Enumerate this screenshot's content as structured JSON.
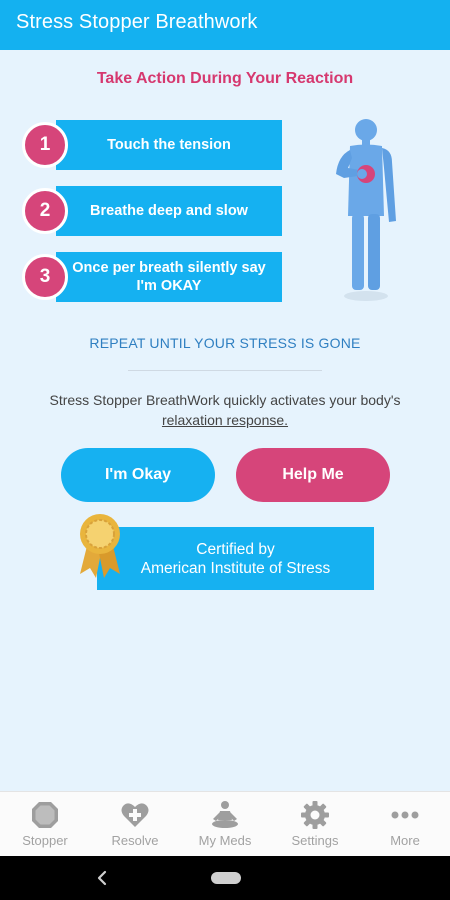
{
  "app": {
    "title": "Stress Stopper Breathwork"
  },
  "main": {
    "headline": "Take Action During Your Reaction",
    "steps": [
      {
        "number": "1",
        "text": "Touch the tension"
      },
      {
        "number": "2",
        "text": "Breathe deep and slow"
      },
      {
        "number": "3",
        "text": "Once per breath silently say I'm OKAY"
      }
    ],
    "repeat_text": "REPEAT UNTIL YOUR STRESS IS GONE",
    "description_prefix": "Stress Stopper BreathWork quickly activates your body's",
    "description_link": "relaxation response.",
    "buttons": {
      "okay": "I'm Okay",
      "help": "Help Me"
    },
    "certification": {
      "line1": "Certified by",
      "line2": "American Institute of Stress"
    }
  },
  "bottom_nav": {
    "items": [
      {
        "label": "Stopper",
        "icon": "octagon-stop-icon"
      },
      {
        "label": "Resolve",
        "icon": "heart-plus-icon"
      },
      {
        "label": "My Meds",
        "icon": "meditation-icon"
      },
      {
        "label": "Settings",
        "icon": "gear-icon"
      },
      {
        "label": "More",
        "icon": "more-dots-icon"
      }
    ]
  },
  "colors": {
    "app_bar": "#14b1f0",
    "accent_blue": "#16b1f1",
    "accent_pink": "#d6457a",
    "headline": "#d6386f",
    "background": "#e6f3fd"
  }
}
